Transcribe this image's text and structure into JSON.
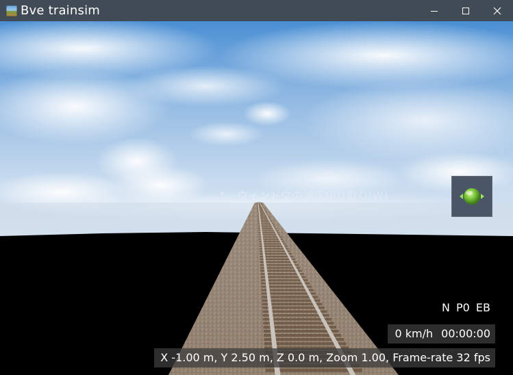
{
  "window": {
    "title": "Bve trainsim",
    "minimize_icon": "minimize-icon",
    "maximize_icon": "maximize-icon",
    "close_icon": "close-icon"
  },
  "overlay": {
    "capture_hint": "ウィンドウの領域切り取り(W)"
  },
  "helper_button": {
    "icon": "green-orb-icon"
  },
  "hud": {
    "notch_status": "N  P0  EB",
    "speed": "0 km/h",
    "clock": "00:00:00",
    "camera_info": "X -1.00 m, Y 2.50 m, Z 0.0 m, Zoom 1.00, Frame-rate 32 fps"
  },
  "colors": {
    "titlebar": "#414b56",
    "sky_top": "#3f86cf",
    "sky_horizon": "#cfdff0",
    "ground": "#000000",
    "ballast": "#8a7a68",
    "rail": "#c8c2bc",
    "sleeper": "#6e5a44",
    "hud_bg": "#3c3c3c"
  }
}
